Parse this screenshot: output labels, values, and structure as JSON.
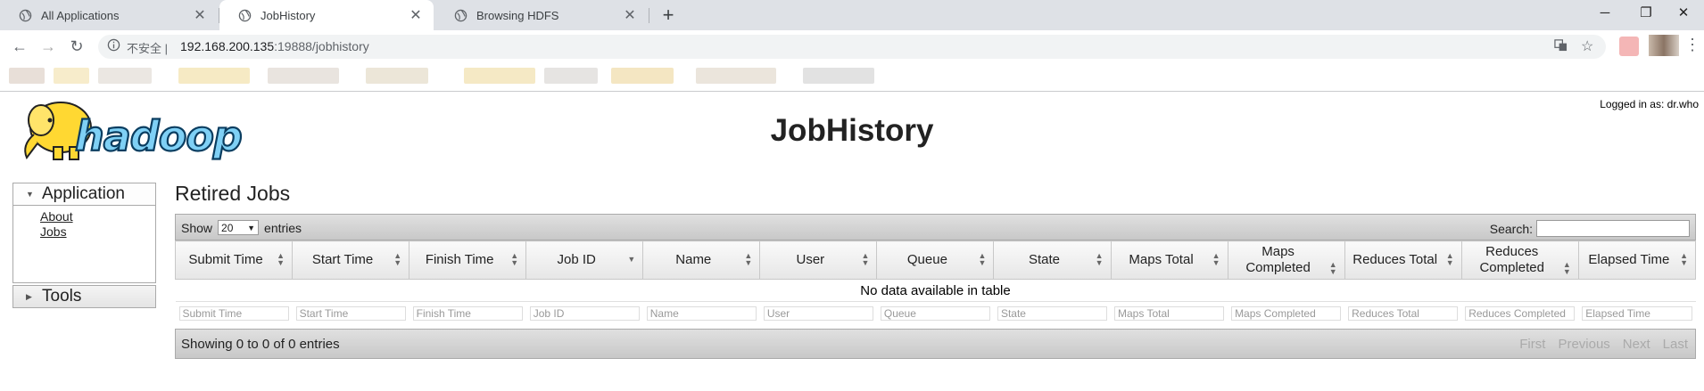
{
  "browser": {
    "tabs": [
      {
        "title": "All Applications"
      },
      {
        "title": "JobHistory",
        "active": true
      },
      {
        "title": "Browsing HDFS"
      }
    ],
    "new_tab": "+",
    "window_controls": [
      "─",
      "❐",
      "✕"
    ],
    "address": {
      "security_label": "不安全",
      "url_host": "192.168.200.135",
      "url_rest": ":19888/jobhistory"
    }
  },
  "page": {
    "logged_in": "Logged in as: dr.who",
    "title": "JobHistory",
    "sidebar": {
      "application": {
        "label": "Application",
        "links": [
          "About",
          "Jobs"
        ]
      },
      "tools": {
        "label": "Tools"
      }
    },
    "section_title": "Retired Jobs",
    "table": {
      "show_label": "Show",
      "entries_value": "20",
      "entries_label": "entries",
      "search_label": "Search:",
      "columns": [
        "Submit Time",
        "Start Time",
        "Finish Time",
        "Job ID",
        "Name",
        "User",
        "Queue",
        "State",
        "Maps Total",
        "Maps Completed",
        "Reduces Total",
        "Reduces Completed",
        "Elapsed Time"
      ],
      "empty_message": "No data available in table",
      "filter_placeholders": [
        "Submit Time",
        "Start Time",
        "Finish Time",
        "Job ID",
        "Name",
        "User",
        "Queue",
        "State",
        "Maps Total",
        "Maps Completed",
        "Reduces Total",
        "Reduces Completed",
        "Elapsed Time"
      ],
      "info": "Showing 0 to 0 of 0 entries",
      "pager": [
        "First",
        "Previous",
        "Next",
        "Last"
      ]
    }
  },
  "colors": {
    "tab_strip": "#dee1e6",
    "logo_elephant": "#ffd832",
    "logo_text": "#0a6aa1"
  }
}
